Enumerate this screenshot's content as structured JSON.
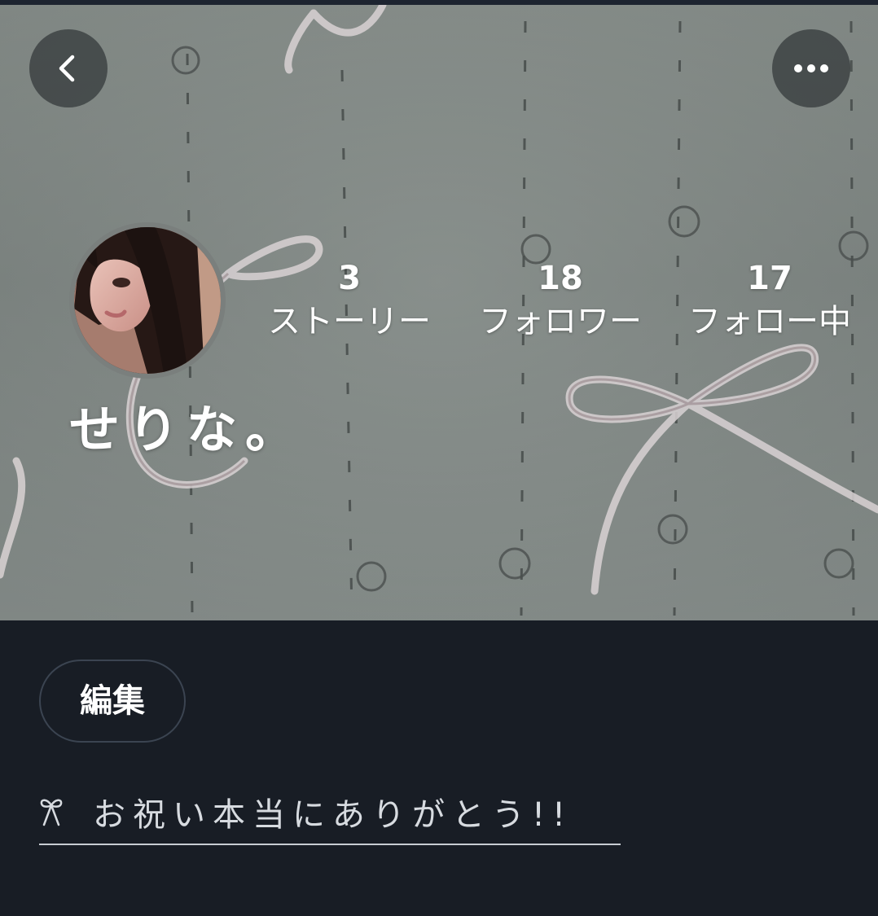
{
  "profile": {
    "display_name": "せりな。",
    "bio": "お祝い本当にありがとう!!",
    "bio_icon": "bow-icon"
  },
  "stats": [
    {
      "count": "3",
      "label": "ストーリー"
    },
    {
      "count": "18",
      "label": "フォロワー"
    },
    {
      "count": "17",
      "label": "フォロー中"
    }
  ],
  "actions": {
    "back_icon": "chevron-left-icon",
    "more_icon": "more-horizontal-icon",
    "edit_label": "編集"
  },
  "colors": {
    "background": "#181d25",
    "text_primary": "#ffffff",
    "text_secondary": "#d7dbe0",
    "button_border": "#3b4451"
  }
}
